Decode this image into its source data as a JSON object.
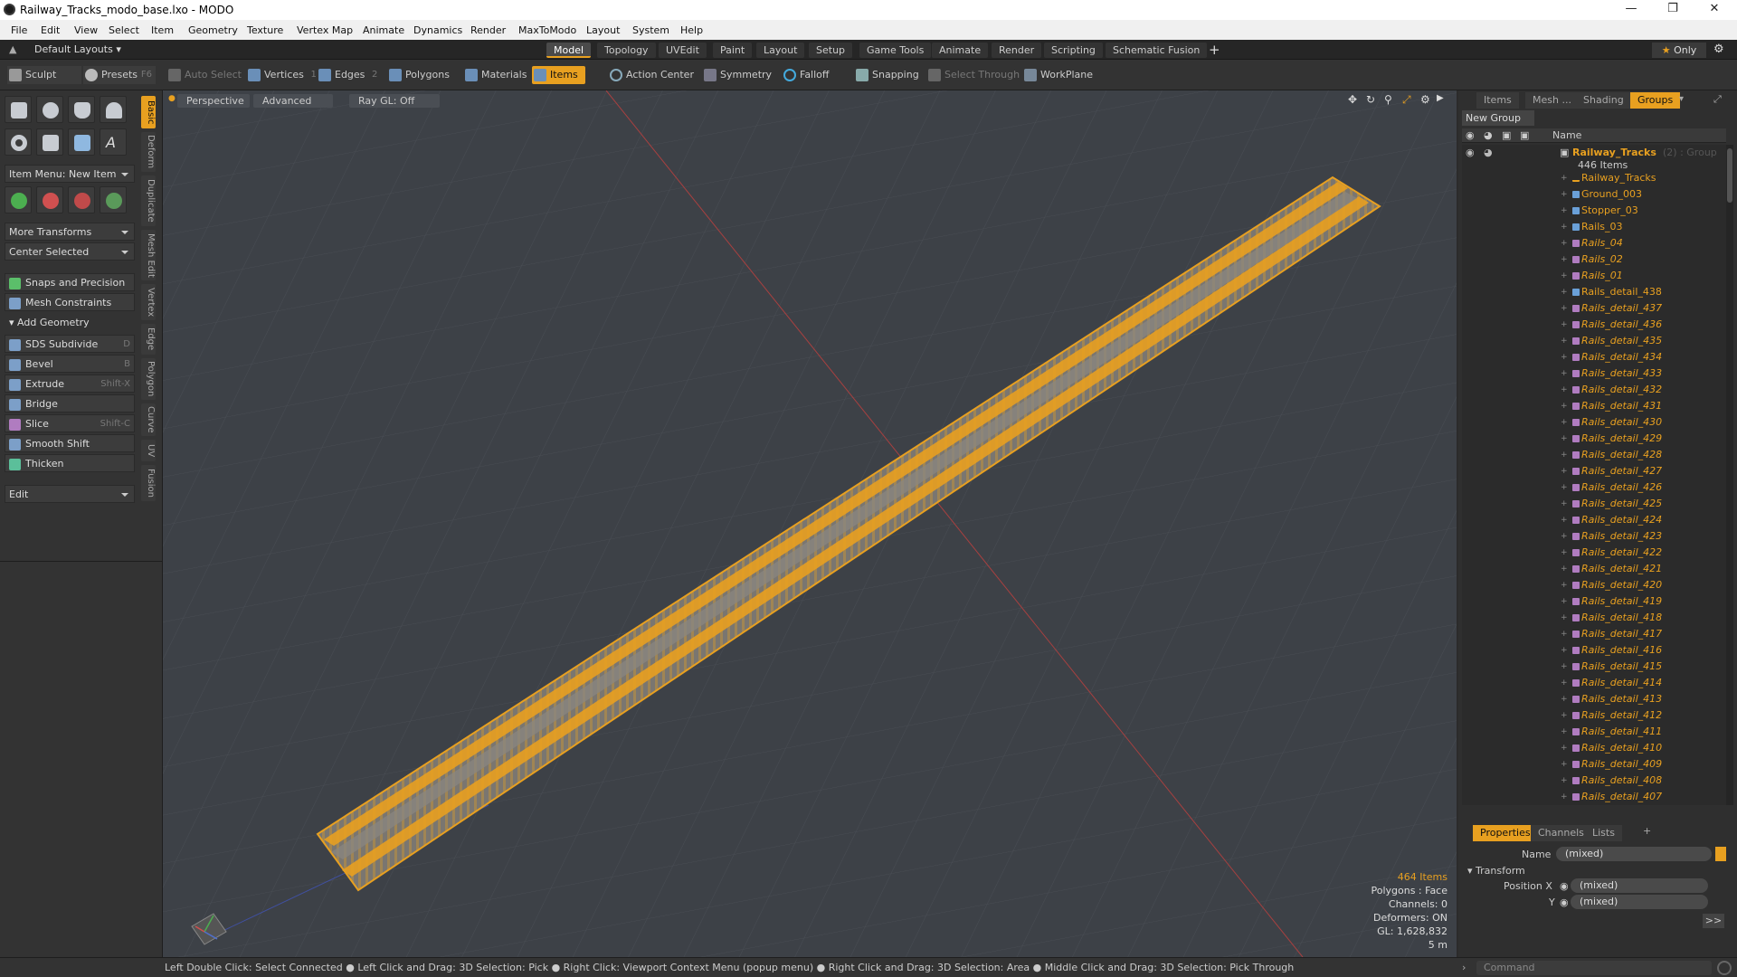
{
  "window": {
    "title": "Railway_Tracks_modo_base.lxo - MODO"
  },
  "menu": [
    "File",
    "Edit",
    "View",
    "Select",
    "Item",
    "Geometry",
    "Texture",
    "Vertex Map",
    "Animate",
    "Dynamics",
    "Render",
    "MaxToModo",
    "Layout",
    "System",
    "Help"
  ],
  "layout": {
    "default_layouts": "Default Layouts",
    "tabs": [
      "Model",
      "Topology",
      "UVEdit",
      "Paint",
      "Layout",
      "Setup",
      "Game Tools",
      "Animate",
      "Render",
      "Scripting",
      "Schematic Fusion"
    ],
    "active_tab": "Model",
    "only": "Only"
  },
  "toolbar": {
    "sculpt": "Sculpt",
    "presets": "Presets",
    "presets_sc": "F6",
    "auto_select": "Auto Select",
    "vertices": "Vertices",
    "vertices_sc": "1",
    "edges": "Edges",
    "edges_sc": "2",
    "polygons": "Polygons",
    "materials": "Materials",
    "items": "Items",
    "action_center": "Action Center",
    "symmetry": "Symmetry",
    "falloff": "Falloff",
    "snapping": "Snapping",
    "select_through": "Select Through",
    "workplane": "WorkPlane"
  },
  "left": {
    "item_menu": "Item Menu: New Item",
    "more_transforms": "More Transforms",
    "center_selected": "Center Selected",
    "snaps": "Snaps and Precision",
    "mesh_constraints": "Mesh Constraints",
    "add_geometry": "Add Geometry",
    "tools": [
      {
        "label": "SDS Subdivide",
        "sc": "D"
      },
      {
        "label": "Bevel",
        "sc": "B"
      },
      {
        "label": "Extrude",
        "sc": "Shift-X"
      },
      {
        "label": "Bridge",
        "sc": ""
      },
      {
        "label": "Slice",
        "sc": "Shift-C"
      },
      {
        "label": "Smooth Shift",
        "sc": ""
      },
      {
        "label": "Thicken",
        "sc": ""
      }
    ],
    "edit": "Edit",
    "vtabs": [
      "Basic",
      "Deform",
      "Duplicate",
      "Mesh Edit",
      "Vertex",
      "Edge",
      "Polygon",
      "Curve",
      "UV",
      "Fusion"
    ]
  },
  "viewport": {
    "perspective": "Perspective",
    "advanced": "Advanced",
    "raygl": "Ray GL: Off",
    "info": {
      "items": "464 Items",
      "polygons": "Polygons : Face",
      "channels": "Channels: 0",
      "deformers": "Deformers: ON",
      "gl": "GL: 1,628,832",
      "scale": "5 m"
    }
  },
  "right": {
    "tabs": [
      "Items",
      "Mesh ...",
      "Shading",
      "Groups"
    ],
    "active_tab": "Groups",
    "new_group": "New Group",
    "name_header": "Name",
    "group": {
      "name": "Railway_Tracks",
      "count": "(2) : Group",
      "items": "446 Items"
    },
    "tree": [
      {
        "name": "Railway_Tracks",
        "italic": false,
        "kind": "loc"
      },
      {
        "name": "Ground_003",
        "italic": false,
        "kind": "blue"
      },
      {
        "name": "Stopper_03",
        "italic": false,
        "kind": "blue"
      },
      {
        "name": "Rails_03",
        "italic": false,
        "kind": "blue"
      },
      {
        "name": "Rails_04",
        "italic": true,
        "kind": "mesh"
      },
      {
        "name": "Rails_02",
        "italic": true,
        "kind": "mesh"
      },
      {
        "name": "Rails_01",
        "italic": true,
        "kind": "mesh"
      },
      {
        "name": "Rails_detail_438",
        "italic": false,
        "kind": "blue"
      },
      {
        "name": "Rails_detail_437",
        "italic": true,
        "kind": "mesh"
      },
      {
        "name": "Rails_detail_436",
        "italic": true,
        "kind": "mesh"
      },
      {
        "name": "Rails_detail_435",
        "italic": true,
        "kind": "mesh"
      },
      {
        "name": "Rails_detail_434",
        "italic": true,
        "kind": "mesh"
      },
      {
        "name": "Rails_detail_433",
        "italic": true,
        "kind": "mesh"
      },
      {
        "name": "Rails_detail_432",
        "italic": true,
        "kind": "mesh"
      },
      {
        "name": "Rails_detail_431",
        "italic": true,
        "kind": "mesh"
      },
      {
        "name": "Rails_detail_430",
        "italic": true,
        "kind": "mesh"
      },
      {
        "name": "Rails_detail_429",
        "italic": true,
        "kind": "mesh"
      },
      {
        "name": "Rails_detail_428",
        "italic": true,
        "kind": "mesh"
      },
      {
        "name": "Rails_detail_427",
        "italic": true,
        "kind": "mesh"
      },
      {
        "name": "Rails_detail_426",
        "italic": true,
        "kind": "mesh"
      },
      {
        "name": "Rails_detail_425",
        "italic": true,
        "kind": "mesh"
      },
      {
        "name": "Rails_detail_424",
        "italic": true,
        "kind": "mesh"
      },
      {
        "name": "Rails_detail_423",
        "italic": true,
        "kind": "mesh"
      },
      {
        "name": "Rails_detail_422",
        "italic": true,
        "kind": "mesh"
      },
      {
        "name": "Rails_detail_421",
        "italic": true,
        "kind": "mesh"
      },
      {
        "name": "Rails_detail_420",
        "italic": true,
        "kind": "mesh"
      },
      {
        "name": "Rails_detail_419",
        "italic": true,
        "kind": "mesh"
      },
      {
        "name": "Rails_detail_418",
        "italic": true,
        "kind": "mesh"
      },
      {
        "name": "Rails_detail_417",
        "italic": true,
        "kind": "mesh"
      },
      {
        "name": "Rails_detail_416",
        "italic": true,
        "kind": "mesh"
      },
      {
        "name": "Rails_detail_415",
        "italic": true,
        "kind": "mesh"
      },
      {
        "name": "Rails_detail_414",
        "italic": true,
        "kind": "mesh"
      },
      {
        "name": "Rails_detail_413",
        "italic": true,
        "kind": "mesh"
      },
      {
        "name": "Rails_detail_412",
        "italic": true,
        "kind": "mesh"
      },
      {
        "name": "Rails_detail_411",
        "italic": true,
        "kind": "mesh"
      },
      {
        "name": "Rails_detail_410",
        "italic": true,
        "kind": "mesh"
      },
      {
        "name": "Rails_detail_409",
        "italic": true,
        "kind": "mesh"
      },
      {
        "name": "Rails_detail_408",
        "italic": true,
        "kind": "mesh"
      },
      {
        "name": "Rails_detail_407",
        "italic": true,
        "kind": "mesh"
      }
    ],
    "props": {
      "tabs": [
        "Properties",
        "Channels",
        "Lists"
      ],
      "name_label": "Name",
      "name_value": "(mixed)",
      "transform": "Transform",
      "posx_label": "Position X",
      "posx_value": "(mixed)",
      "y_label": "Y",
      "y_value": "(mixed)",
      "more": ">>"
    },
    "command_placeholder": "Command"
  },
  "statusbar": "Left Double Click: Select Connected ● Left Click and Drag: 3D Selection: Pick ● Right Click: Viewport Context Menu (popup menu) ● Right Click and Drag: 3D Selection: Area ● Middle Click and Drag: 3D Selection: Pick Through",
  "colors": {
    "accent": "#e8a020",
    "viewport_bg": "#3d4147",
    "mesh_item": "#b07cc0"
  }
}
